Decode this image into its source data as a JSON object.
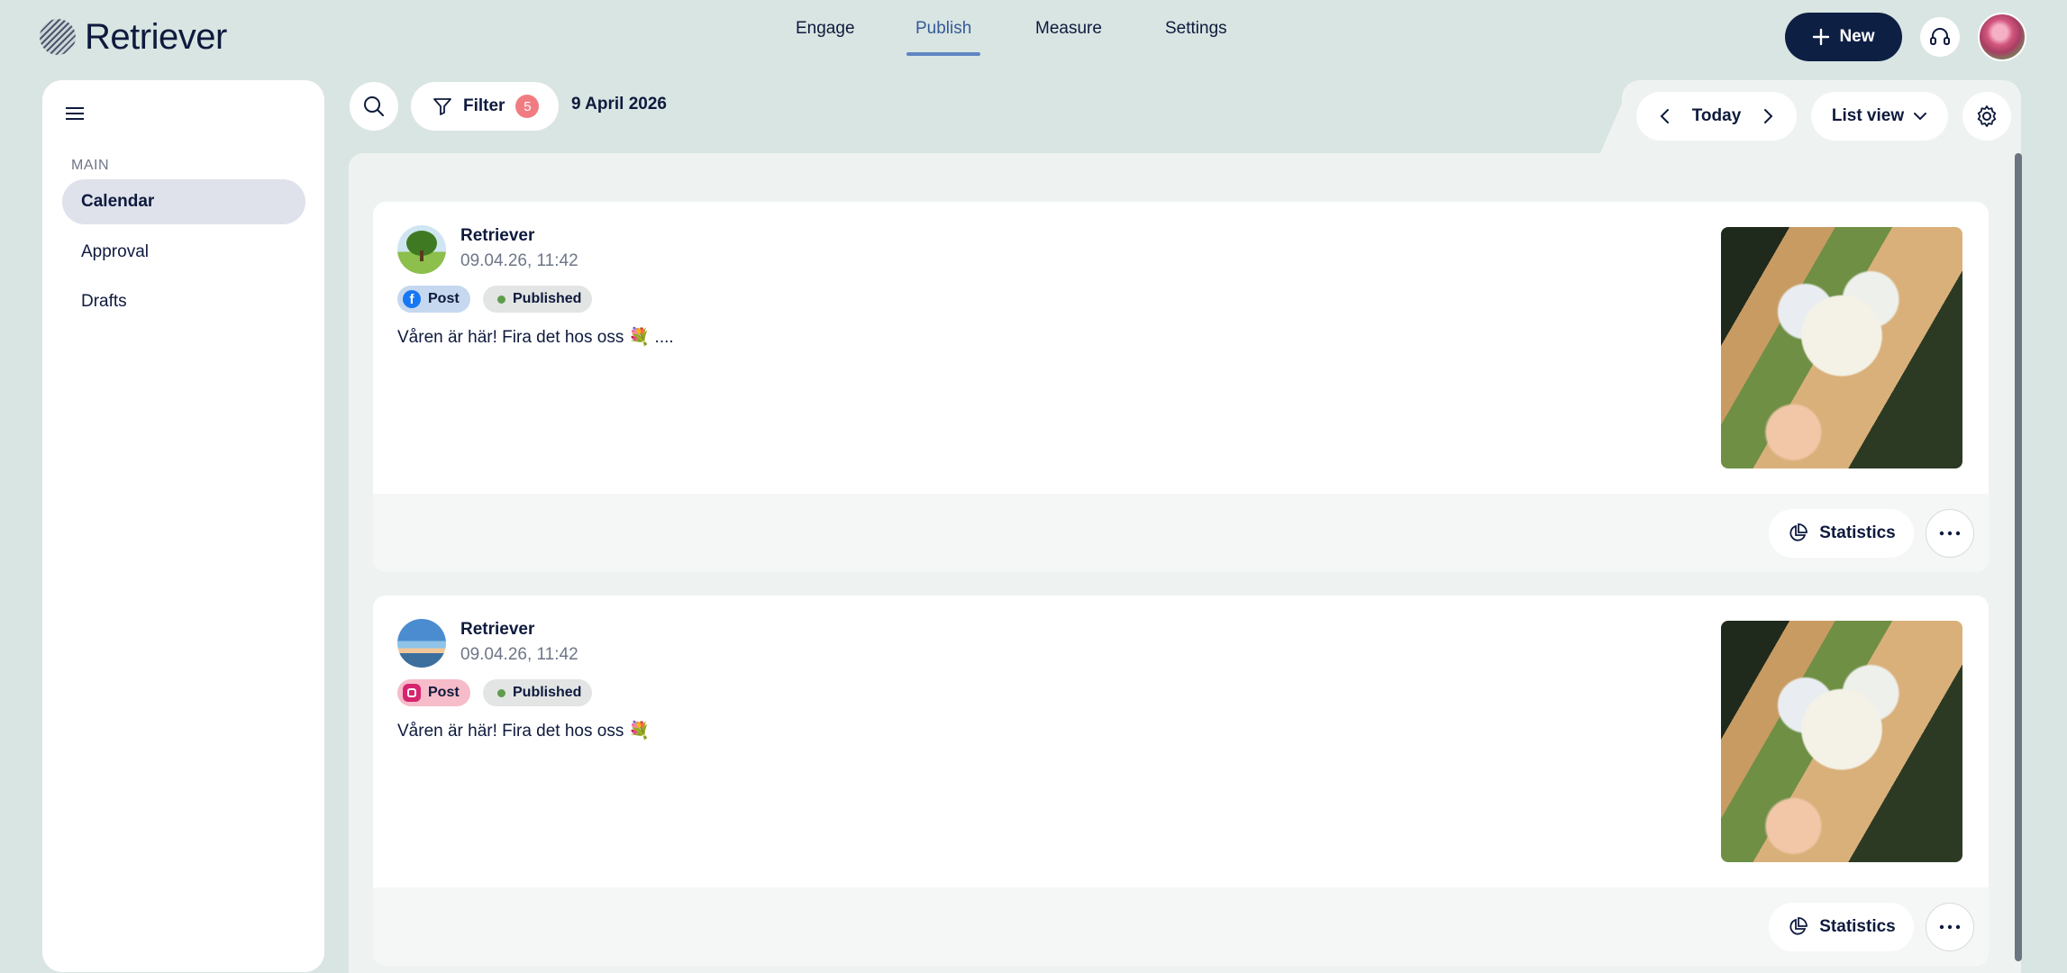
{
  "app": {
    "name": "Retriever"
  },
  "nav": {
    "engage": "Engage",
    "publish": "Publish",
    "measure": "Measure",
    "settings": "Settings"
  },
  "header": {
    "new_label": "New"
  },
  "sidebar": {
    "section": "MAIN",
    "items": [
      {
        "label": "Calendar",
        "active": true
      },
      {
        "label": "Approval",
        "active": false
      },
      {
        "label": "Drafts",
        "active": false
      }
    ]
  },
  "toolbar": {
    "filter_label": "Filter",
    "filter_count": "5",
    "date": "9 April 2026",
    "today_label": "Today",
    "view_label": "List view"
  },
  "posts": [
    {
      "account": "Retriever",
      "time": "09.04.26, 11:42",
      "channel": "facebook",
      "type_label": "Post",
      "status": "Published",
      "text": "Våren är här! Fira det hos oss 💐 ....",
      "stats_label": "Statistics"
    },
    {
      "account": "Retriever",
      "time": "09.04.26, 11:42",
      "channel": "instagram",
      "type_label": "Post",
      "status": "Published",
      "text": "Våren är här! Fira det hos oss 💐",
      "stats_label": "Statistics"
    }
  ],
  "colors": {
    "background": "#d9e5e2",
    "primary": "#0e1f44",
    "active_tab": "#5f86c3",
    "filter_badge": "#f07c82",
    "published_dot": "#5f9d4c"
  }
}
